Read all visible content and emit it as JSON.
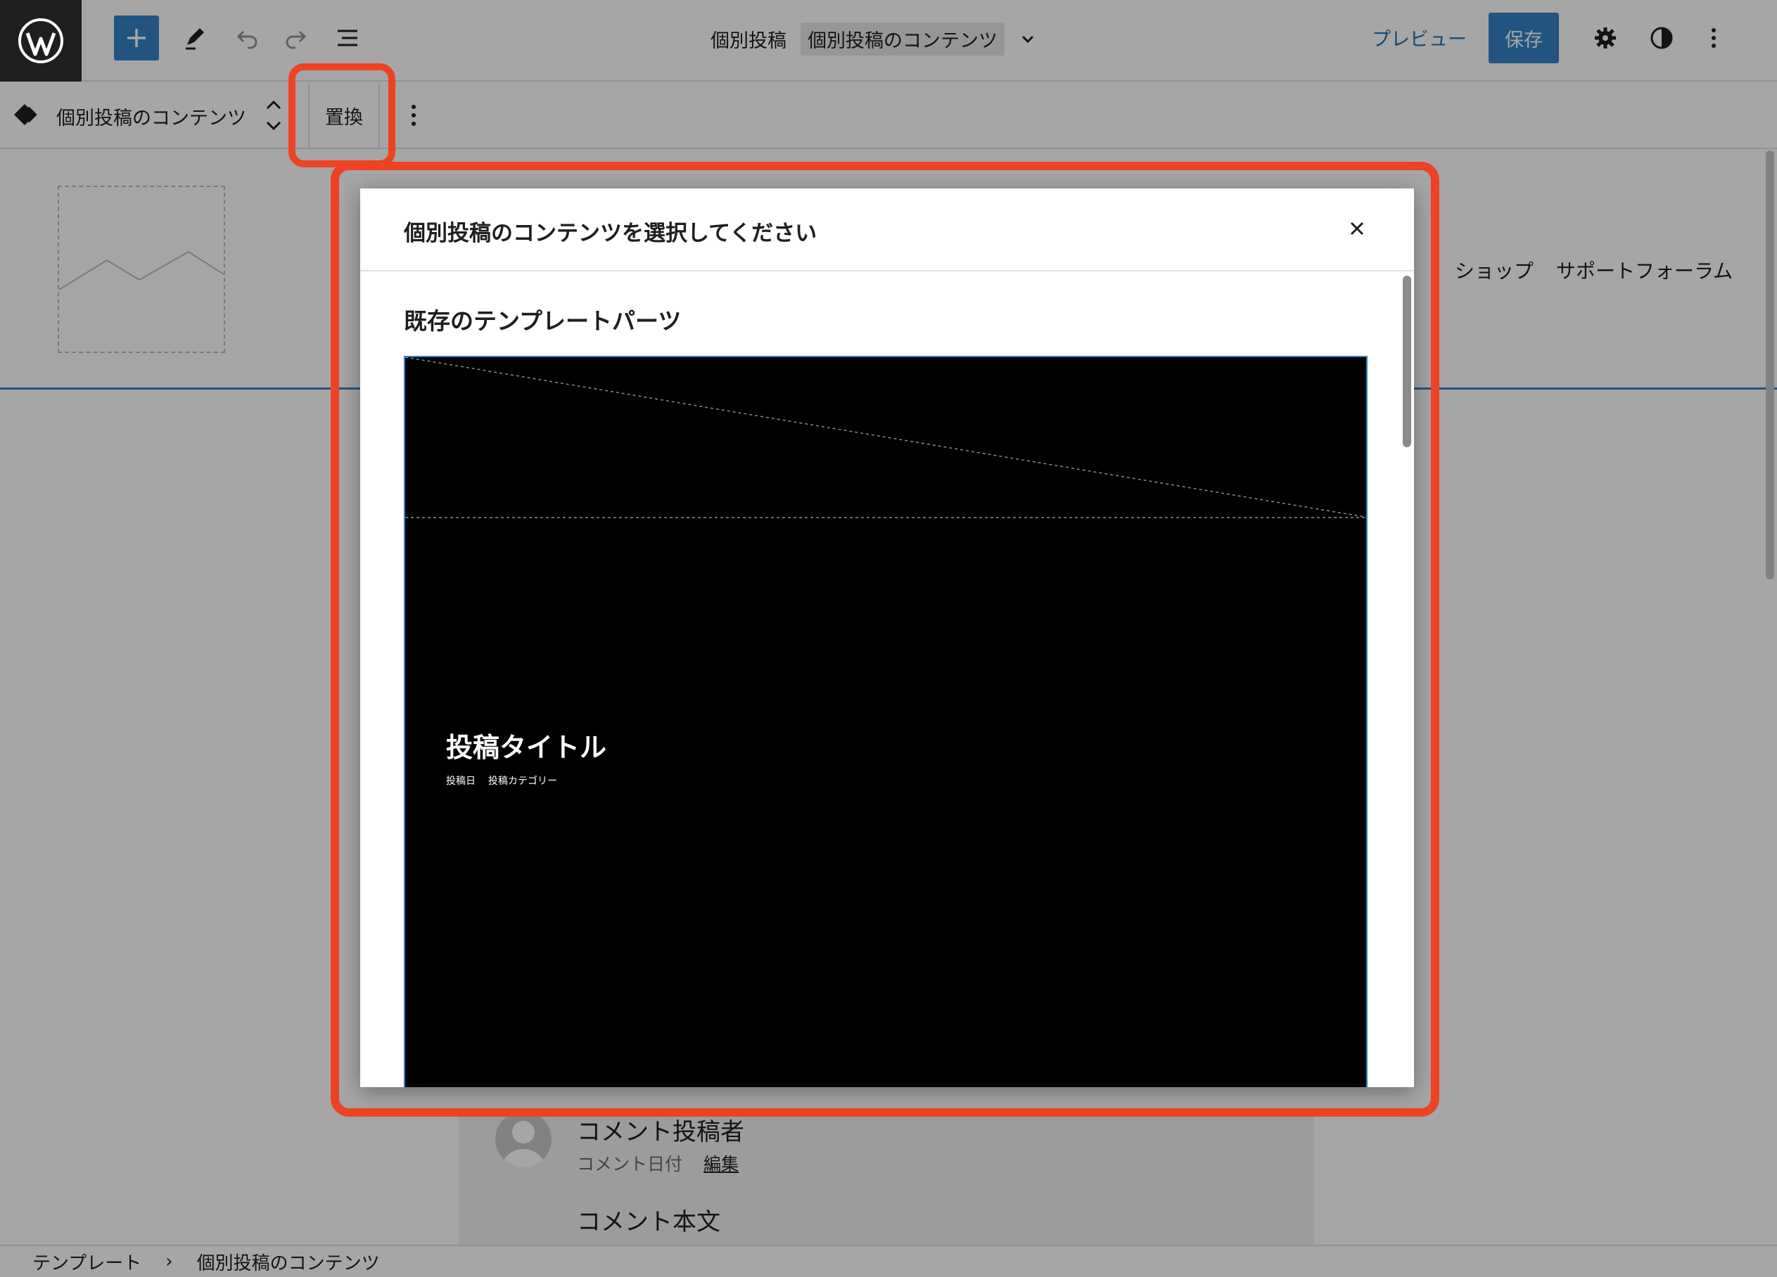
{
  "topbar": {
    "add_label": "+",
    "doc_type": "個別投稿",
    "doc_template": "個別投稿のコンテンツ",
    "preview": "プレビュー",
    "save": "保存"
  },
  "blockbar": {
    "block_name": "個別投稿のコンテンツ",
    "replace": "置換"
  },
  "header_nav": [
    "ショップ",
    "サポートフォーラム"
  ],
  "comments": {
    "author": "コメント投稿者",
    "date": "コメント日付",
    "edit": "編集",
    "body": "コメント本文"
  },
  "breadcrumb": [
    "テンプレート",
    "個別投稿のコンテンツ"
  ],
  "breadcrumb_sep": "›",
  "modal": {
    "title": "個別投稿のコンテンツを選択してください",
    "section": "既存のテンプレートパーツ",
    "preview": {
      "post_title": "投稿タイトル",
      "meta": [
        "投稿日",
        "投稿カテゴリー"
      ]
    }
  },
  "colors": {
    "highlight": "#ee4323",
    "accent": "#3582c4",
    "link": "#2271b1"
  }
}
